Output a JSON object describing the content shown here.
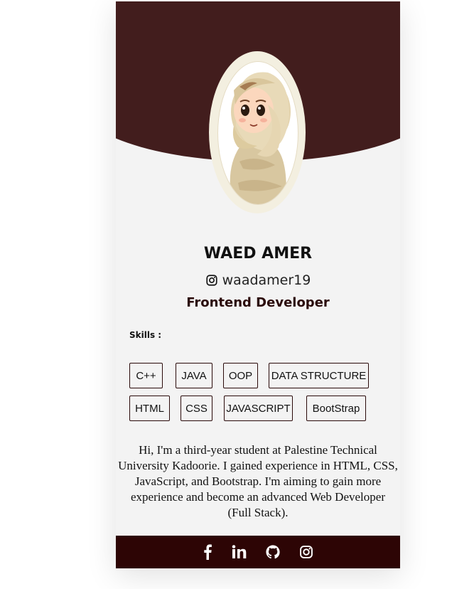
{
  "profile": {
    "name": "WAED AMER",
    "handle": "waadamer19",
    "role": "Frontend Developer",
    "bio": "Hi, I'm a third-year student at Palestine Technical University Kadoorie. I gained experience in HTML, CSS, JavaScript, and Bootstrap. I'm aiming to gain more experience and become an advanced Web Developer (Full Stack).",
    "avatar_icon": "hijab-girl-avatar"
  },
  "skills": {
    "label": "Skills :",
    "items": [
      "C++",
      "JAVA",
      "OOP",
      "DATA STRUCTURE",
      "HTML",
      "CSS",
      "JAVASCRIPT",
      "BootStrap"
    ]
  },
  "footer": {
    "icons": [
      "facebook-icon",
      "linkedin-icon",
      "github-icon",
      "instagram-icon"
    ]
  },
  "colors": {
    "header": "#421d1d",
    "footer": "#2d0505",
    "card": "#f3f3f3"
  }
}
